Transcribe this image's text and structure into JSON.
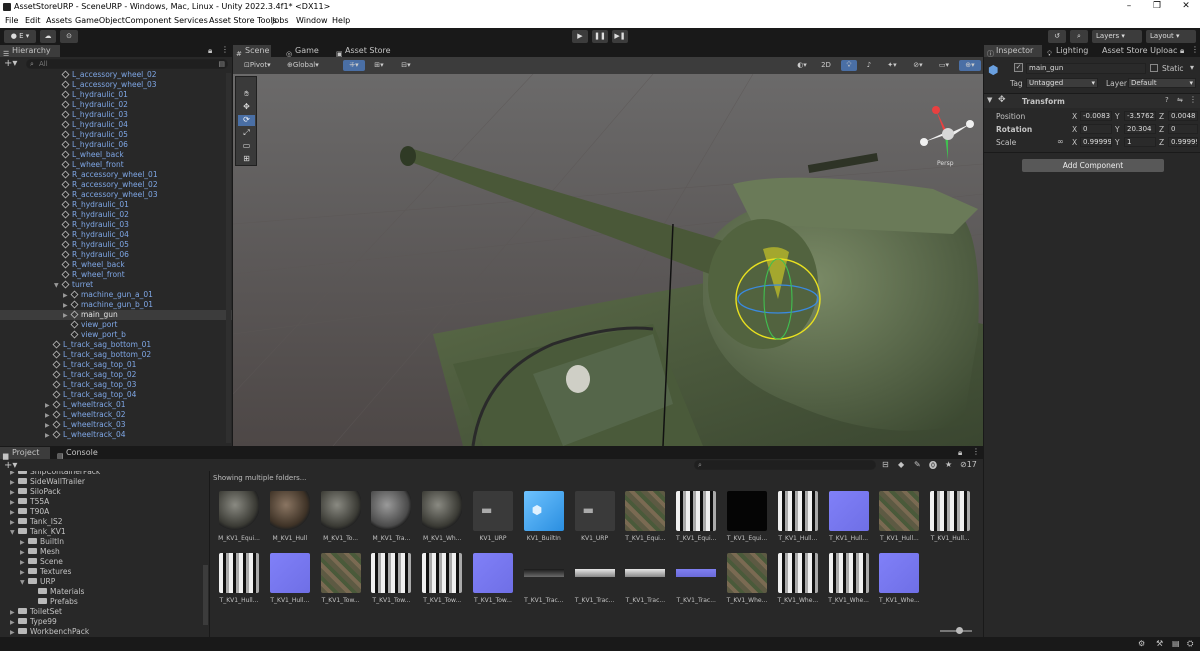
{
  "window": {
    "title": "AssetStoreURP - SceneURP - Windows, Mac, Linux - Unity 2022.3.4f1* <DX11>",
    "controls": [
      "–",
      "❐",
      "✕"
    ]
  },
  "menu": [
    "File",
    "Edit",
    "Assets",
    "GameObject",
    "Component",
    "Services",
    "Asset Store Tools",
    "Jobs",
    "Window",
    "Help"
  ],
  "toolbar": {
    "account": "E",
    "play": "▶",
    "pause": "❚❚",
    "step": "▶❚",
    "layers": "Layers",
    "layout": "Layout"
  },
  "hierarchy": {
    "tab": "Hierarchy",
    "search_placeholder": "All",
    "rows": [
      {
        "label": "L_accessory_wheel_02",
        "depth": 6,
        "arrow": false,
        "sel": false
      },
      {
        "label": "L_accessory_wheel_03",
        "depth": 6,
        "arrow": false,
        "sel": false
      },
      {
        "label": "L_hydraulic_01",
        "depth": 6,
        "arrow": false,
        "sel": false
      },
      {
        "label": "L_hydraulic_02",
        "depth": 6,
        "arrow": false,
        "sel": false
      },
      {
        "label": "L_hydraulic_03",
        "depth": 6,
        "arrow": false,
        "sel": false
      },
      {
        "label": "L_hydraulic_04",
        "depth": 6,
        "arrow": false,
        "sel": false
      },
      {
        "label": "L_hydraulic_05",
        "depth": 6,
        "arrow": false,
        "sel": false
      },
      {
        "label": "L_hydraulic_06",
        "depth": 6,
        "arrow": false,
        "sel": false
      },
      {
        "label": "L_wheel_back",
        "depth": 6,
        "arrow": false,
        "sel": false
      },
      {
        "label": "L_wheel_front",
        "depth": 6,
        "arrow": false,
        "sel": false
      },
      {
        "label": "R_accessory_wheel_01",
        "depth": 6,
        "arrow": false,
        "sel": false
      },
      {
        "label": "R_accessory_wheel_02",
        "depth": 6,
        "arrow": false,
        "sel": false
      },
      {
        "label": "R_accessory_wheel_03",
        "depth": 6,
        "arrow": false,
        "sel": false
      },
      {
        "label": "R_hydraulic_01",
        "depth": 6,
        "arrow": false,
        "sel": false
      },
      {
        "label": "R_hydraulic_02",
        "depth": 6,
        "arrow": false,
        "sel": false
      },
      {
        "label": "R_hydraulic_03",
        "depth": 6,
        "arrow": false,
        "sel": false
      },
      {
        "label": "R_hydraulic_04",
        "depth": 6,
        "arrow": false,
        "sel": false
      },
      {
        "label": "R_hydraulic_05",
        "depth": 6,
        "arrow": false,
        "sel": false
      },
      {
        "label": "R_hydraulic_06",
        "depth": 6,
        "arrow": false,
        "sel": false
      },
      {
        "label": "R_wheel_back",
        "depth": 6,
        "arrow": false,
        "sel": false
      },
      {
        "label": "R_wheel_front",
        "depth": 6,
        "arrow": false,
        "sel": false
      },
      {
        "label": "turret",
        "depth": 6,
        "arrow": "▼",
        "sel": false
      },
      {
        "label": "machine_gun_a_01",
        "depth": 7,
        "arrow": "▶",
        "sel": false
      },
      {
        "label": "machine_gun_b_01",
        "depth": 7,
        "arrow": "▶",
        "sel": false
      },
      {
        "label": "main_gun",
        "depth": 7,
        "arrow": "▶",
        "sel": true
      },
      {
        "label": "view_port",
        "depth": 7,
        "arrow": false,
        "sel": false
      },
      {
        "label": "view_port_b",
        "depth": 7,
        "arrow": false,
        "sel": false
      },
      {
        "label": "L_track_sag_bottom_01",
        "depth": 5,
        "arrow": false,
        "sel": false
      },
      {
        "label": "L_track_sag_bottom_02",
        "depth": 5,
        "arrow": false,
        "sel": false
      },
      {
        "label": "L_track_sag_top_01",
        "depth": 5,
        "arrow": false,
        "sel": false
      },
      {
        "label": "L_track_sag_top_02",
        "depth": 5,
        "arrow": false,
        "sel": false
      },
      {
        "label": "L_track_sag_top_03",
        "depth": 5,
        "arrow": false,
        "sel": false
      },
      {
        "label": "L_track_sag_top_04",
        "depth": 5,
        "arrow": false,
        "sel": false
      },
      {
        "label": "L_wheeltrack_01",
        "depth": 5,
        "arrow": "▶",
        "sel": false
      },
      {
        "label": "L_wheeltrack_02",
        "depth": 5,
        "arrow": "▶",
        "sel": false
      },
      {
        "label": "L_wheeltrack_03",
        "depth": 5,
        "arrow": "▶",
        "sel": false
      },
      {
        "label": "L_wheeltrack_04",
        "depth": 5,
        "arrow": "▶",
        "sel": false
      }
    ]
  },
  "scene": {
    "tabs": [
      "Scene",
      "Game",
      "Asset Store"
    ],
    "pivot": "Pivot",
    "global": "Global",
    "mode_2d": "2D",
    "gizmo_label": "Persp"
  },
  "project": {
    "tabs": [
      "Project",
      "Console"
    ],
    "folders": [
      {
        "label": "ShipContainerPack",
        "depth": 1,
        "sel": false
      },
      {
        "label": "SideWallTrailer",
        "depth": 1,
        "sel": false
      },
      {
        "label": "SiloPack",
        "depth": 1,
        "sel": false
      },
      {
        "label": "T55A",
        "depth": 1,
        "sel": false
      },
      {
        "label": "T90A",
        "depth": 1,
        "sel": false
      },
      {
        "label": "Tank_IS2",
        "depth": 1,
        "sel": false
      },
      {
        "label": "Tank_KV1",
        "depth": 1,
        "sel": false
      },
      {
        "label": "BuiltIn",
        "depth": 2,
        "sel": false
      },
      {
        "label": "Mesh",
        "depth": 2,
        "sel": false
      },
      {
        "label": "Scene",
        "depth": 2,
        "sel": false
      },
      {
        "label": "Textures",
        "depth": 2,
        "sel": false
      },
      {
        "label": "URP",
        "depth": 2,
        "sel": false
      },
      {
        "label": "Materials",
        "depth": 3,
        "sel": false
      },
      {
        "label": "Prefabs",
        "depth": 3,
        "sel": false
      },
      {
        "label": "ToiletSet",
        "depth": 1,
        "sel": false
      },
      {
        "label": "Type99",
        "depth": 1,
        "sel": false
      },
      {
        "label": "WorkbenchPack",
        "depth": 1,
        "sel": false
      }
    ],
    "breadcrumb": "Showing multiple folders...",
    "hidden_count": "17",
    "assets": [
      {
        "label": "M_KV1_Equi...",
        "kind": "sphere-dark"
      },
      {
        "label": "M_KV1_Hull",
        "kind": "sphere-brown"
      },
      {
        "label": "M_KV1_To...",
        "kind": "sphere-dark"
      },
      {
        "label": "M_KV1_Tra...",
        "kind": "sphere-grey"
      },
      {
        "label": "M_KV1_Wh...",
        "kind": "sphere-dark"
      },
      {
        "label": "KV1_URP",
        "kind": "mesh"
      },
      {
        "label": "KV1_BuiltIn",
        "kind": "prefab"
      },
      {
        "label": "KV1_URP",
        "kind": "mesh"
      },
      {
        "label": "T_KV1_Equi...",
        "kind": "tex-camo"
      },
      {
        "label": "T_KV1_Equi...",
        "kind": "tex-bw"
      },
      {
        "label": "T_KV1_Equi...",
        "kind": "tex-black"
      },
      {
        "label": "T_KV1_Hull...",
        "kind": "tex-bw"
      },
      {
        "label": "T_KV1_Hull...",
        "kind": "tex-normal"
      },
      {
        "label": "T_KV1_Hull...",
        "kind": "tex-camo"
      },
      {
        "label": "T_KV1_Hull...",
        "kind": "tex-bw"
      },
      {
        "label": "T_KV1_Hull...",
        "kind": "tex-bw"
      },
      {
        "label": "T_KV1_Hull...",
        "kind": "tex-normal"
      },
      {
        "label": "T_KV1_Tow...",
        "kind": "tex-camo"
      },
      {
        "label": "T_KV1_Tow...",
        "kind": "tex-bw"
      },
      {
        "label": "T_KV1_Tow...",
        "kind": "tex-bw"
      },
      {
        "label": "T_KV1_Tow...",
        "kind": "tex-normal"
      },
      {
        "label": "T_KV1_Trac...",
        "kind": "strip-dark"
      },
      {
        "label": "T_KV1_Trac...",
        "kind": "strip-light"
      },
      {
        "label": "T_KV1_Trac...",
        "kind": "strip-light"
      },
      {
        "label": "T_KV1_Trac...",
        "kind": "strip-blue"
      },
      {
        "label": "T_KV1_Whe...",
        "kind": "tex-camo"
      },
      {
        "label": "T_KV1_Whe...",
        "kind": "tex-bw"
      },
      {
        "label": "T_KV1_Whe...",
        "kind": "tex-bw"
      },
      {
        "label": "T_KV1_Whe...",
        "kind": "tex-normal"
      }
    ]
  },
  "inspector": {
    "tabs": [
      "Inspector",
      "Lighting",
      "Asset Store Uploac"
    ],
    "object_name": "main_gun",
    "static_label": "Static",
    "tag_label": "Tag",
    "tag_value": "Untagged",
    "layer_label": "Layer",
    "layer_value": "Default",
    "component": "Transform",
    "position_label": "Position",
    "rotation_label": "Rotation",
    "scale_label": "Scale",
    "position": {
      "x": "-0.0083",
      "y": "-3.5762",
      "z": "0.0048"
    },
    "rotation": {
      "x": "0",
      "y": "20.304",
      "z": "0"
    },
    "scale": {
      "x": "0.99999",
      "y": "1",
      "z": "0.99999"
    },
    "axis_x": "X",
    "axis_y": "Y",
    "axis_z": "Z",
    "add_component": "Add Component"
  },
  "colors": {
    "accent": "#3e5b8a",
    "hierarchy_text": "#7fa7e6",
    "panel": "#282828",
    "dark": "#191919"
  }
}
